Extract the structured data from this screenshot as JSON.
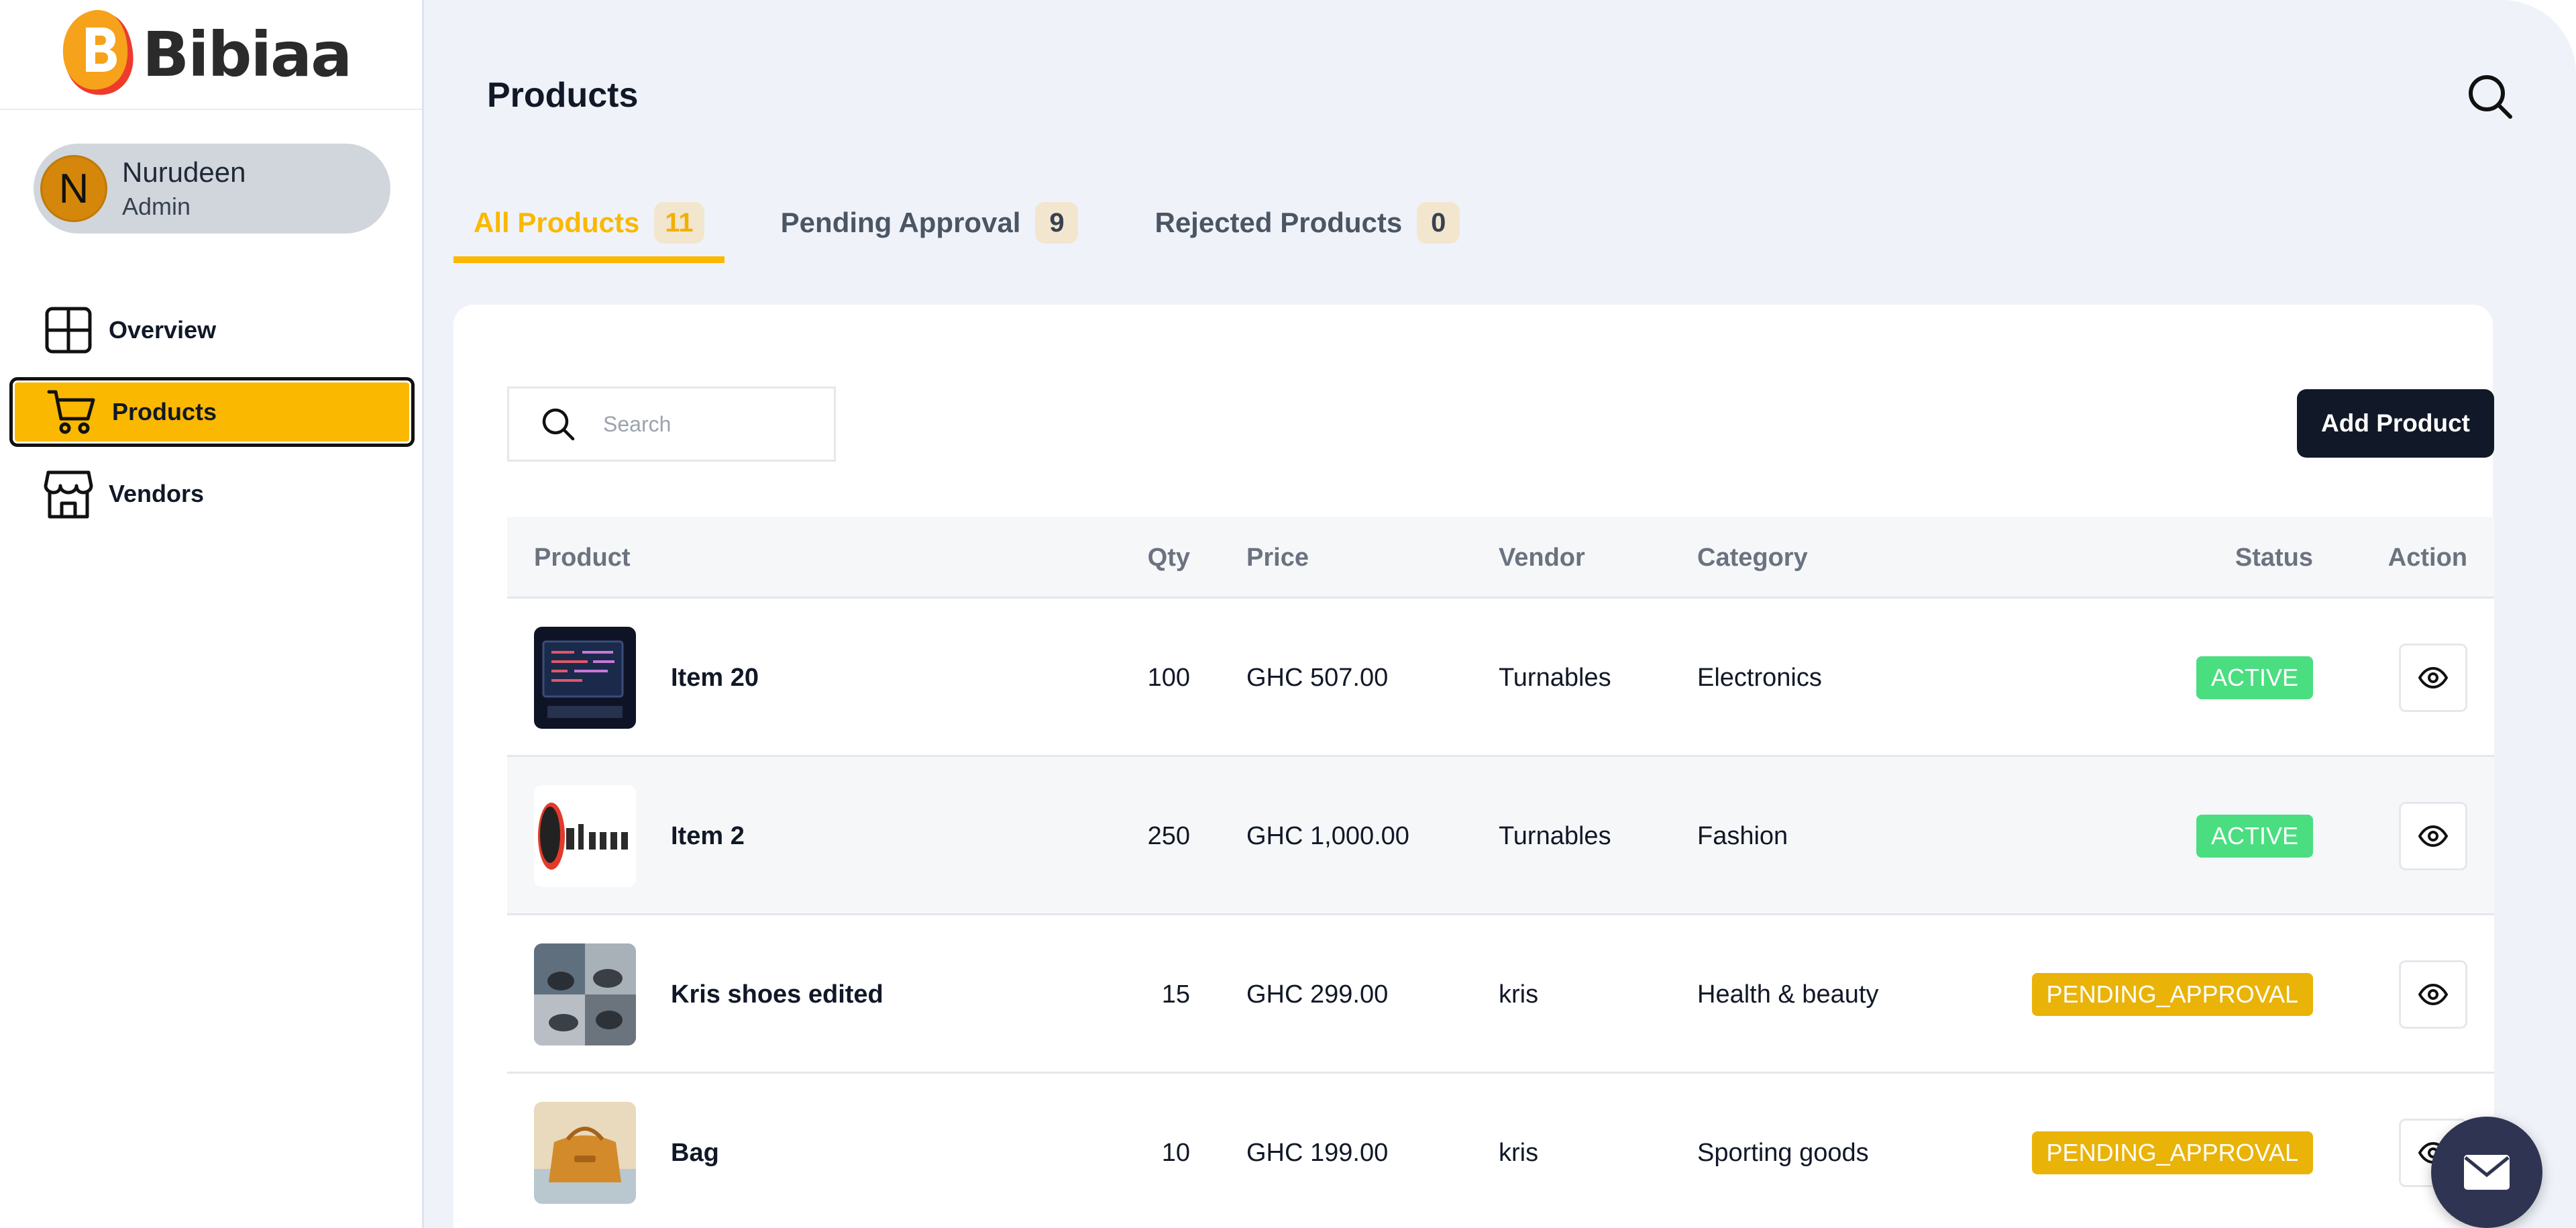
{
  "brand": {
    "name": "Bibiaa",
    "mark": "B"
  },
  "user": {
    "initial": "N",
    "name": "Nurudeen",
    "role": "Admin"
  },
  "nav": [
    {
      "label": "Overview",
      "icon": "grid-icon"
    },
    {
      "label": "Products",
      "icon": "cart-icon",
      "active": true
    },
    {
      "label": "Vendors",
      "icon": "store-icon"
    }
  ],
  "page": {
    "title": "Products"
  },
  "tabs": [
    {
      "label": "All Products",
      "count": "11",
      "active": true
    },
    {
      "label": "Pending Approval",
      "count": "9"
    },
    {
      "label": "Rejected Products",
      "count": "0"
    }
  ],
  "search": {
    "placeholder": "Search"
  },
  "toolbar": {
    "add_label": "Add Product"
  },
  "table": {
    "columns": [
      "Product",
      "Qty",
      "Price",
      "Vendor",
      "Category",
      "Status",
      "Action"
    ],
    "rows": [
      {
        "name": "Item 20",
        "qty": "100",
        "price": "GHC 507.00",
        "vendor": "Turnables",
        "category": "Electronics",
        "status": "ACTIVE"
      },
      {
        "name": "Item 2",
        "qty": "250",
        "price": "GHC 1,000.00",
        "vendor": "Turnables",
        "category": "Fashion",
        "status": "ACTIVE"
      },
      {
        "name": "Kris shoes edited",
        "qty": "15",
        "price": "GHC 299.00",
        "vendor": "kris",
        "category": "Health & beauty",
        "status": "PENDING_APPROVAL"
      },
      {
        "name": "Bag",
        "qty": "10",
        "price": "GHC 199.00",
        "vendor": "kris",
        "category": "Sporting goods",
        "status": "PENDING_APPROVAL"
      }
    ]
  },
  "colors": {
    "accent": "#fbb800",
    "active_status": "#4ade80",
    "pending_status": "#eab308",
    "dark": "#111827"
  }
}
